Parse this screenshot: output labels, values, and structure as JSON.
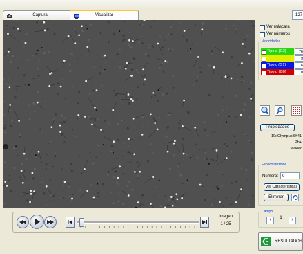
{
  "tabs": [
    {
      "label": "Captura",
      "active": false
    },
    {
      "label": "Visualizar",
      "active": true
    }
  ],
  "frame_counter": "127",
  "options": {
    "ver_mascara": "Ver máscara",
    "ver_numeros": "Ver números"
  },
  "velocidades": {
    "legend": "Velocidades",
    "rows": [
      {
        "label": "Tipo a (G3)",
        "value": "76",
        "color": "#2ad612",
        "checked": true
      },
      {
        "label": "Tipo b (G2)",
        "value": "9",
        "color": "#e0ee00",
        "checked": true
      },
      {
        "label": "Tipo c (G1)",
        "value": "6",
        "color": "#0a1ae0",
        "checked": true
      },
      {
        "label": "Tipo d (G0)",
        "value": "10",
        "color": "#d00000",
        "checked": true
      }
    ]
  },
  "toolbar_icons": [
    "zoom-in-icon",
    "zoom-out-icon",
    "grid-icon"
  ],
  "propiedades_label": "Propiedades",
  "equipment": [
    "10xOlympusBX41",
    "Ph+",
    "Makler"
  ],
  "espermatozoide": {
    "legend": "Espermatozoide",
    "numero_label": "Número:",
    "numero_value": "0",
    "ver_caracteristicas": "Ver Características",
    "eliminar": "Eliminar"
  },
  "campo": {
    "legend": "Campo",
    "value": "1"
  },
  "resultados_label": "RESULTADOS",
  "imagen": {
    "label": "Imagen",
    "counter": "1 / 25"
  },
  "colors": {
    "accent": "#0046d5",
    "tab_highlight": "#ffc83c",
    "image_bg": "#4a4a4a"
  }
}
